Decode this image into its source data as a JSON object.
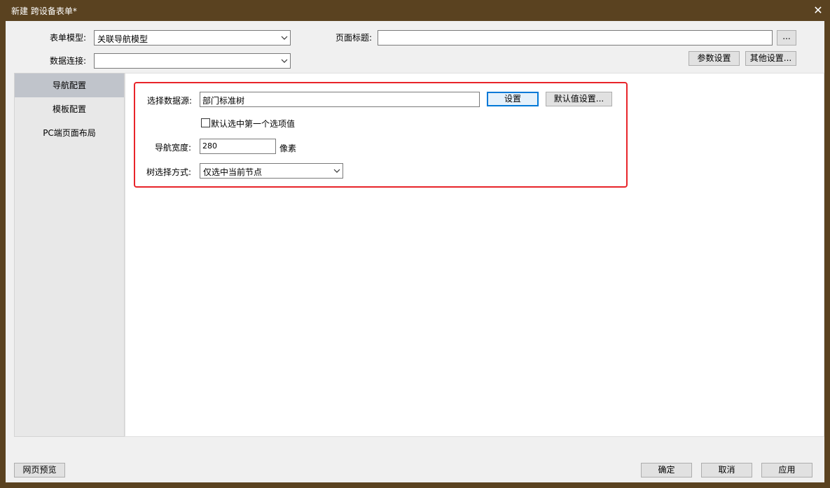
{
  "window": {
    "title": "新建 跨设备表单*"
  },
  "form": {
    "model_label": "表单模型:",
    "model_value": "关联导航模型",
    "connection_label": "数据连接:",
    "connection_value": "",
    "page_title_label": "页面标题:",
    "page_title_value": "",
    "browse_label": "...",
    "params_button": "参数设置",
    "other_button": "其他设置..."
  },
  "sidebar": {
    "items": [
      {
        "label": "导航配置",
        "active": true
      },
      {
        "label": "模板配置",
        "active": false
      },
      {
        "label": "PC端页面布局",
        "active": false
      }
    ]
  },
  "nav_config": {
    "datasource_label": "选择数据源:",
    "datasource_value": "部门标准树",
    "settings_button": "设置",
    "default_button": "默认值设置...",
    "checkbox_label": "默认选中第一个选项值",
    "checkbox_checked": false,
    "width_label": "导航宽度:",
    "width_value": "280",
    "width_unit": "像素",
    "tree_mode_label": "树选择方式:",
    "tree_mode_value": "仅选中当前节点"
  },
  "footer": {
    "preview_button": "网页预览",
    "ok_button": "确定",
    "cancel_button": "取消",
    "apply_button": "应用"
  },
  "colors": {
    "titlebar": "#5a4220",
    "highlight_border": "#e8242a",
    "sidebar_active": "#c0c4cb"
  }
}
